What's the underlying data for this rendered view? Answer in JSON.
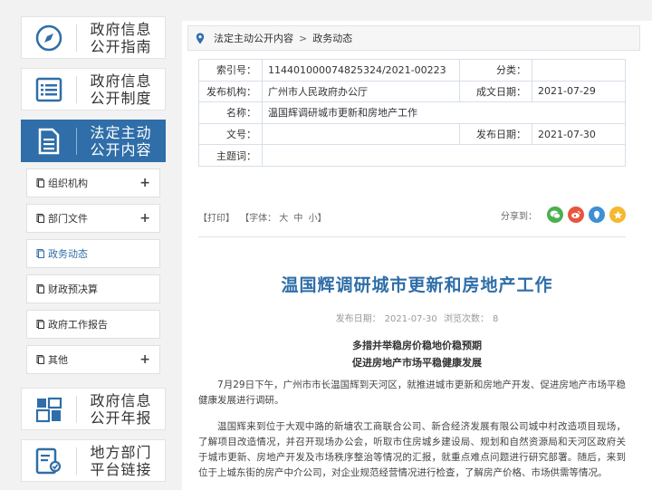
{
  "sidebar": {
    "top_items": [
      {
        "label": "政府信息\n公开指南",
        "icon": "compass-icon"
      },
      {
        "label": "政府信息\n公开制度",
        "icon": "list-icon"
      },
      {
        "label": "法定主动\n公开内容",
        "icon": "document-icon"
      }
    ],
    "sub_items": [
      {
        "label": "组织机构",
        "expand": "+"
      },
      {
        "label": "部门文件",
        "expand": "+"
      },
      {
        "label": "政务动态",
        "expand": ""
      },
      {
        "label": "财政预决算",
        "expand": ""
      },
      {
        "label": "政府工作报告",
        "expand": ""
      },
      {
        "label": "其他",
        "expand": "+"
      }
    ],
    "bottom_items": [
      {
        "label": "政府信息\n公开年报",
        "icon": "report-icon"
      },
      {
        "label": "地方部门\n平台链接",
        "icon": "link-icon"
      }
    ],
    "active_color": "#2f6ea8"
  },
  "breadcrumb": {
    "items": [
      "法定主动公开内容",
      "政务动态"
    ],
    "separator": ">"
  },
  "meta": {
    "index_label": "索引号：",
    "index_value": "114401000074825324/2021-00223",
    "category_label": "分类：",
    "category_value": "",
    "publisher_label": "发布机构：",
    "publisher_value": "广州市人民政府办公厅",
    "created_label": "成文日期：",
    "created_value": "2021-07-29",
    "name_label": "名称：",
    "name_value": "温国辉调研城市更新和房地产工作",
    "docno_label": "文号：",
    "docno_value": "",
    "published_label": "发布日期：",
    "published_value": "2021-07-30",
    "subject_label": "主题词：",
    "subject_value": ""
  },
  "toolbar": {
    "print": "【打印】",
    "font_label": "【字体：",
    "font_large": "大",
    "font_medium": "中",
    "font_small": "小】",
    "share_label": "分享到：",
    "share_icons": [
      "wechat-icon",
      "weibo-icon",
      "qzone-icon",
      "favorite-icon"
    ]
  },
  "article": {
    "title": "温国辉调研城市更新和房地产工作",
    "pub_label": "发布日期：",
    "pub_date": "2021-07-30",
    "views_label": "浏览次数：",
    "views": "8",
    "subhead1": "多措并举稳房价稳地价稳预期",
    "subhead2": "促进房地产市场平稳健康发展",
    "para1": "7月29日下午，广州市市长温国辉到天河区，就推进城市更新和房地产开发、促进房地产市场平稳健康发展进行调研。",
    "para2": "温国辉来到位于大观中路的新塘农工商联合公司、新合经济发展有限公司城中村改造项目现场，了解项目改造情况，并召开现场办公会，听取市住房城乡建设局、规划和自然资源局和天河区政府关于城市更新、房地产开发及市场秩序整治等情况的汇报，就重点难点问题进行研究部署。随后，来到位于上城东街的房产中介公司，对企业规范经营情况进行检查，了解房产价格、市场供需等情况。"
  }
}
